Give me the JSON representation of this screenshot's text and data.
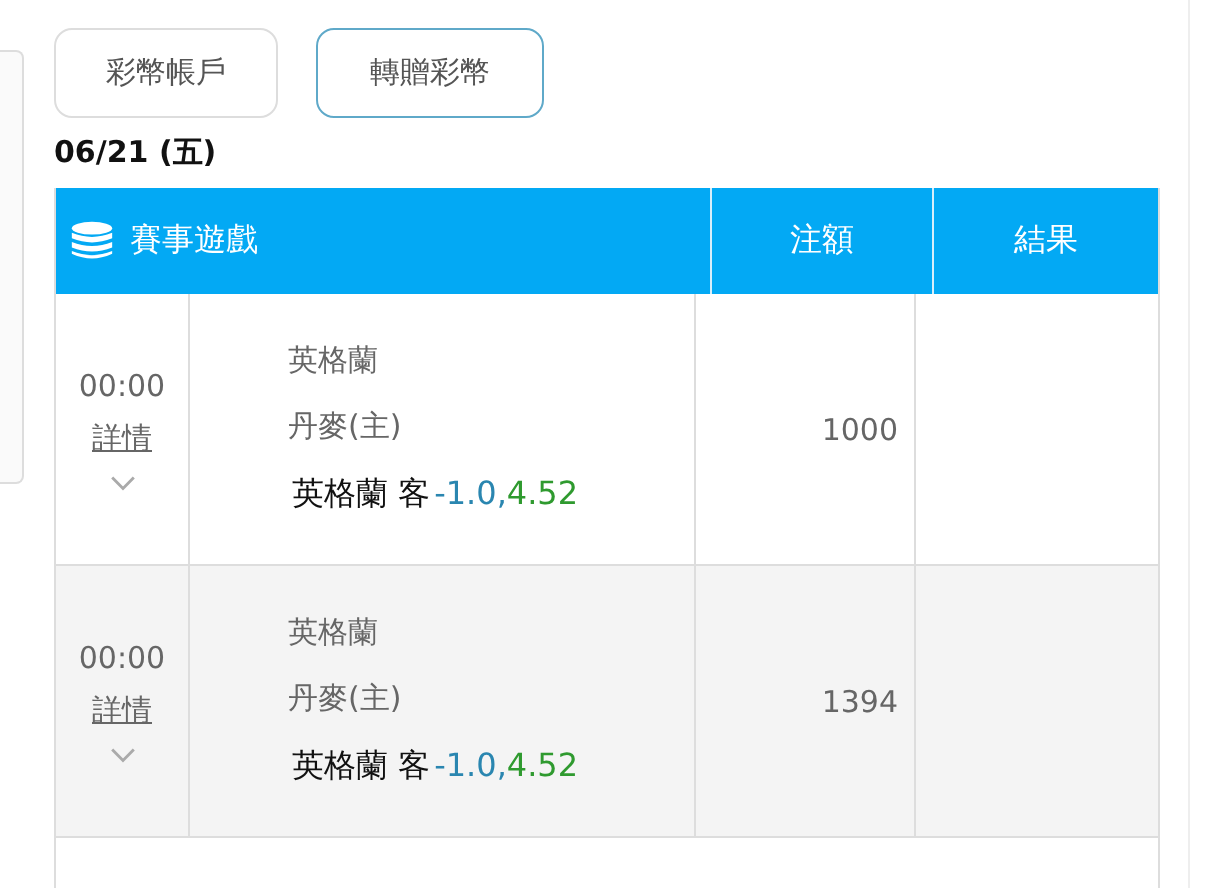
{
  "tabs": [
    {
      "label": "彩幣帳戶",
      "selected": false
    },
    {
      "label": "轉贈彩幣",
      "selected": true
    }
  ],
  "date": "06/21 (五)",
  "table": {
    "columns": [
      "賽事遊戲",
      "注額",
      "結果"
    ],
    "rows": [
      {
        "time": "00:00",
        "details_link": "詳情",
        "team_1": "英格蘭",
        "team_2": "丹麥(主)",
        "pick": "英格蘭 客",
        "handicap": "-1.0,",
        "odds": "4.52",
        "stake": "1000"
      },
      {
        "time": "00:00",
        "details_link": "詳情",
        "team_1": "英格蘭",
        "team_2": "丹麥(主)",
        "pick": "英格蘭 客",
        "handicap": "-1.0,",
        "odds": "4.52",
        "stake": "1394"
      }
    ]
  }
}
